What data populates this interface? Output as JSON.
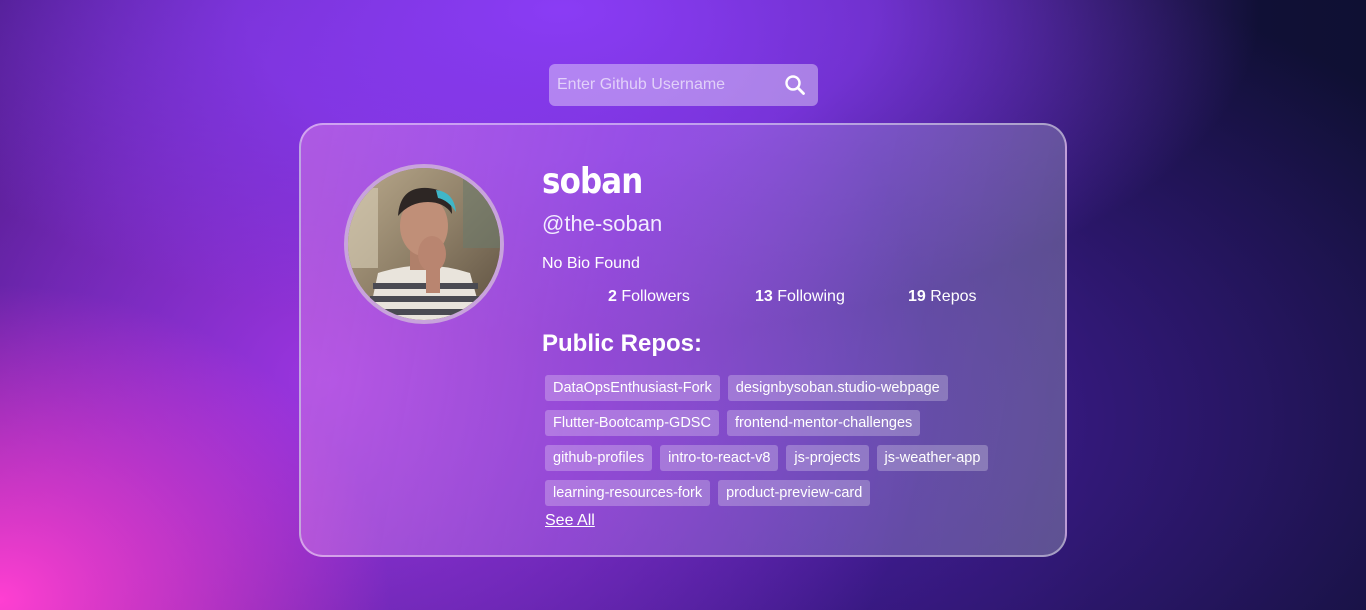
{
  "search": {
    "placeholder": "Enter Github Username",
    "value": "",
    "icon": "search-icon"
  },
  "profile": {
    "name": "soban",
    "handle": "@the-soban",
    "bio": "No Bio Found",
    "avatar_alt": "profile photo"
  },
  "stats": [
    {
      "count": "2",
      "label": "Followers"
    },
    {
      "count": "13",
      "label": "Following"
    },
    {
      "count": "19",
      "label": "Repos"
    }
  ],
  "repos": {
    "title": "Public Repos:",
    "rows": [
      [
        "DataOpsEnthusiast-Fork",
        "designbysoban.studio-webpage"
      ],
      [
        "Flutter-Bootcamp-GDSC",
        "frontend-mentor-challenges"
      ],
      [
        "github-profiles",
        "intro-to-react-v8",
        "js-projects",
        "js-weather-app"
      ],
      [
        "learning-resources-fork",
        "product-preview-card"
      ]
    ],
    "see_all": "See All"
  },
  "colors": {
    "accent_pink": "#ff3fd2",
    "accent_purple": "#8a3cf5",
    "background_dark": "#0f1033"
  }
}
